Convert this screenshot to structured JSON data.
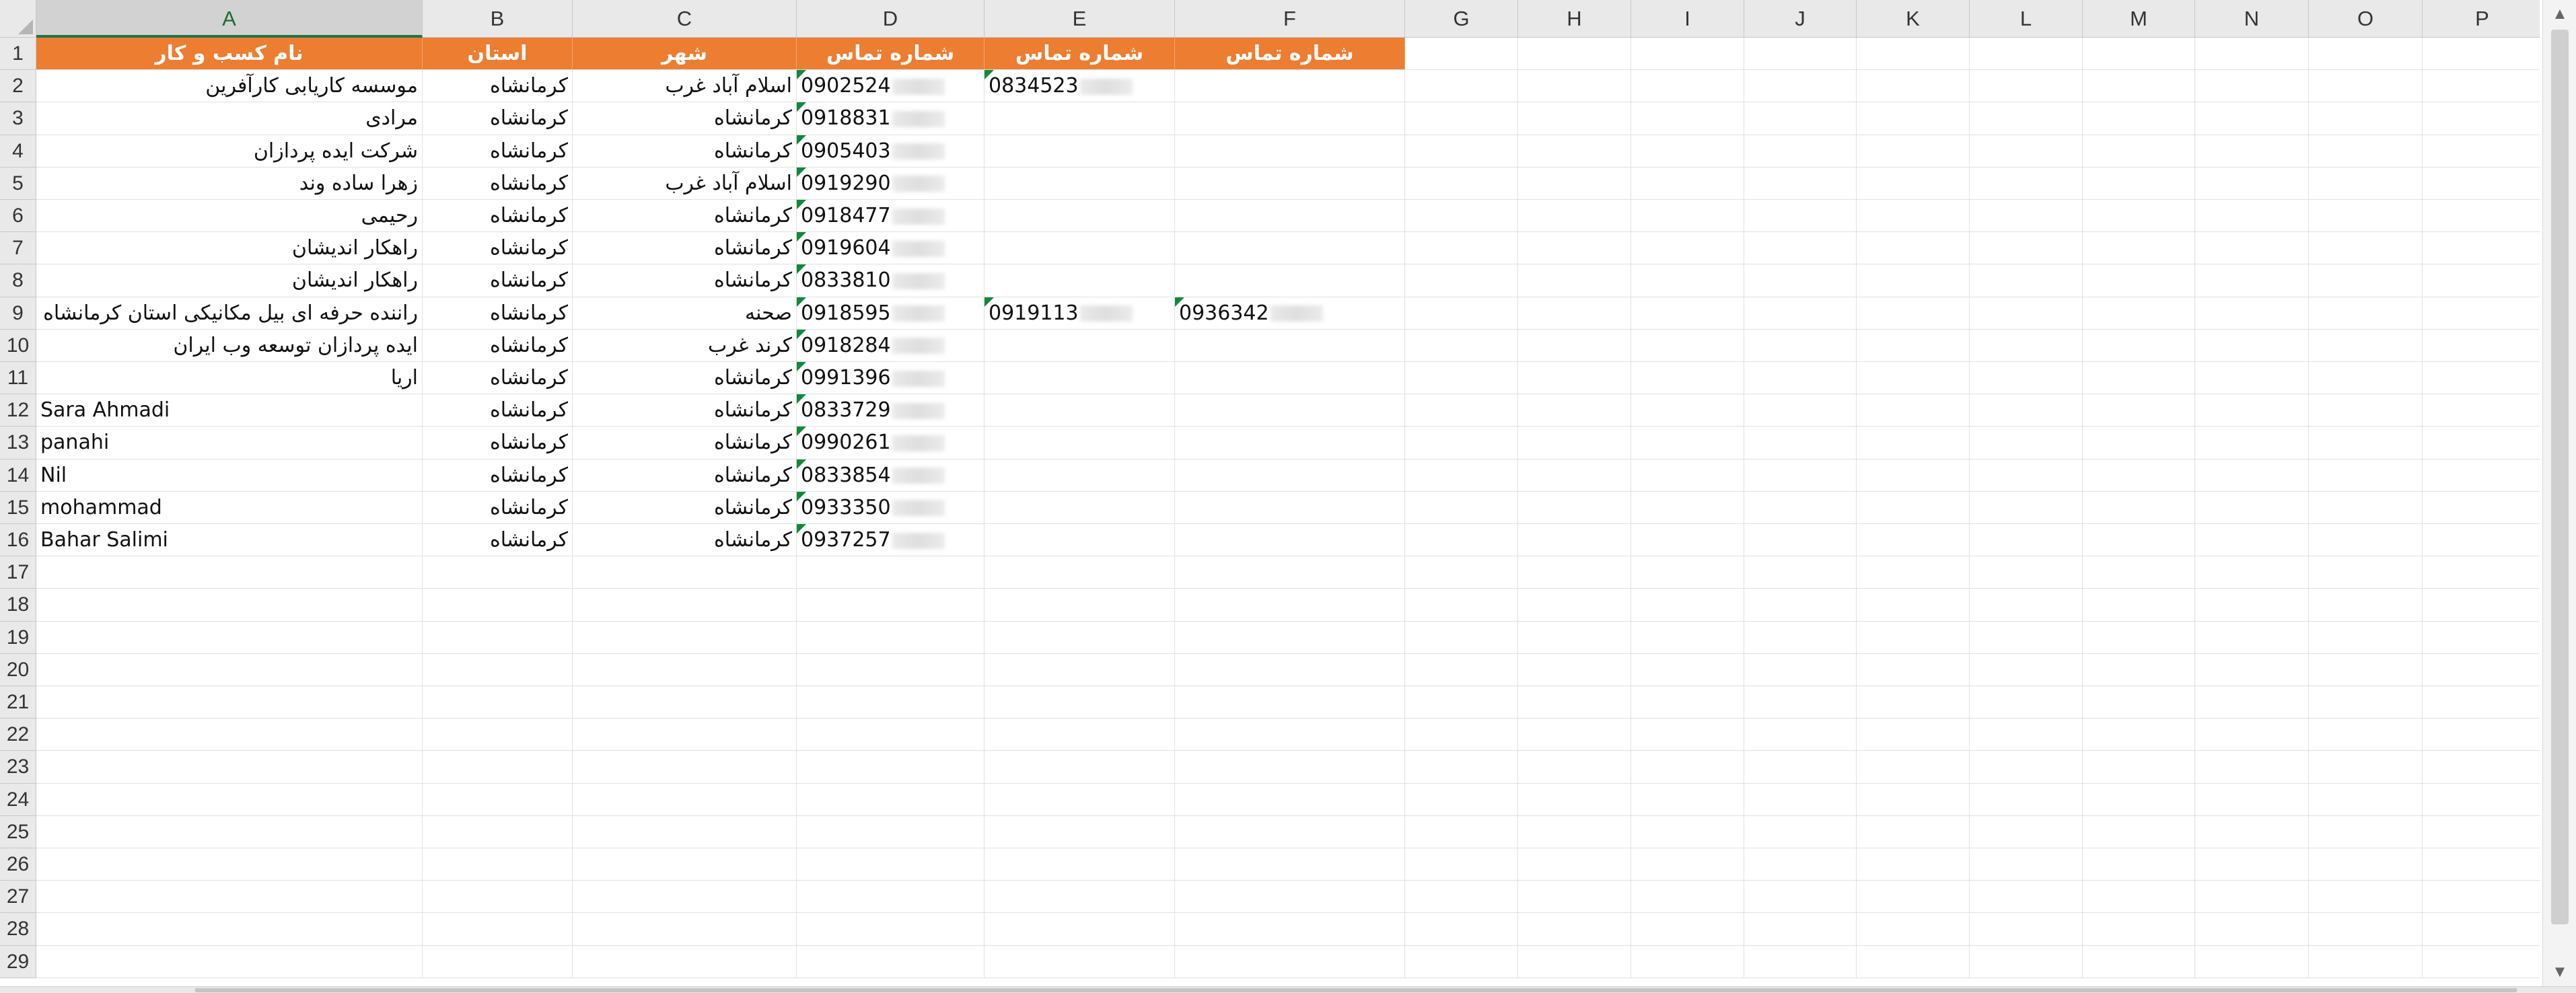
{
  "columns": [
    "A",
    "B",
    "C",
    "D",
    "E",
    "F",
    "G",
    "H",
    "I",
    "J",
    "K",
    "L",
    "M",
    "N",
    "O",
    "P"
  ],
  "selected_column": "A",
  "header_row": {
    "A": "نام کسب و کار",
    "B": "استان",
    "C": "شهر",
    "D": "شماره تماس",
    "E": "شماره تماس",
    "F": "شماره تماس"
  },
  "rows": [
    {
      "A": "موسسه کاریابی کارآفرین",
      "B": "کرمانشاه",
      "C": "اسلام آباد غرب",
      "D": "0902524",
      "E": "0834523",
      "F": ""
    },
    {
      "A": "مرادی",
      "B": "کرمانشاه",
      "C": "کرمانشاه",
      "D": "0918831",
      "E": "",
      "F": ""
    },
    {
      "A": "شرکت ایده پردازان",
      "B": "کرمانشاه",
      "C": "کرمانشاه",
      "D": "0905403",
      "E": "",
      "F": ""
    },
    {
      "A": "زهرا ساده وند",
      "B": "کرمانشاه",
      "C": "اسلام آباد غرب",
      "D": "0919290",
      "E": "",
      "F": ""
    },
    {
      "A": "رحیمی",
      "B": "کرمانشاه",
      "C": "کرمانشاه",
      "D": "0918477",
      "E": "",
      "F": ""
    },
    {
      "A": "راهکار اندیشان",
      "B": "کرمانشاه",
      "C": "کرمانشاه",
      "D": "0919604",
      "E": "",
      "F": ""
    },
    {
      "A": "راهکار اندیشان",
      "B": "کرمانشاه",
      "C": "کرمانشاه",
      "D": "0833810",
      "E": "",
      "F": ""
    },
    {
      "A": "راننده حرفه ای بیل مکانیکی استان کرمانشاه",
      "B": "کرمانشاه",
      "C": "صحنه",
      "D": "0918595",
      "E": "0919113",
      "F": "0936342"
    },
    {
      "A": "ایده پردازان توسعه وب ایران",
      "B": "کرمانشاه",
      "C": "کرند غرب",
      "D": "0918284",
      "E": "",
      "F": ""
    },
    {
      "A": "اریا",
      "B": "کرمانشاه",
      "C": "کرمانشاه",
      "D": "0991396",
      "E": "",
      "F": ""
    },
    {
      "A": "Sara Ahmadi",
      "B": "کرمانشاه",
      "C": "کرمانشاه",
      "D": "0833729",
      "E": "",
      "F": ""
    },
    {
      "A": "panahi",
      "B": "کرمانشاه",
      "C": "کرمانشاه",
      "D": "0990261",
      "E": "",
      "F": ""
    },
    {
      "A": "Nil",
      "B": "کرمانشاه",
      "C": "کرمانشاه",
      "D": "0833854",
      "E": "",
      "F": ""
    },
    {
      "A": "mohammad",
      "B": "کرمانشاه",
      "C": "کرمانشاه",
      "D": "0933350",
      "E": "",
      "F": ""
    },
    {
      "A": "Bahar Salimi",
      "B": "کرمانشاه",
      "C": "کرمانشاه",
      "D": "0937257",
      "E": "",
      "F": ""
    }
  ],
  "row_count": 29,
  "header_color": "#ed7d31",
  "selected_color": "#217346"
}
